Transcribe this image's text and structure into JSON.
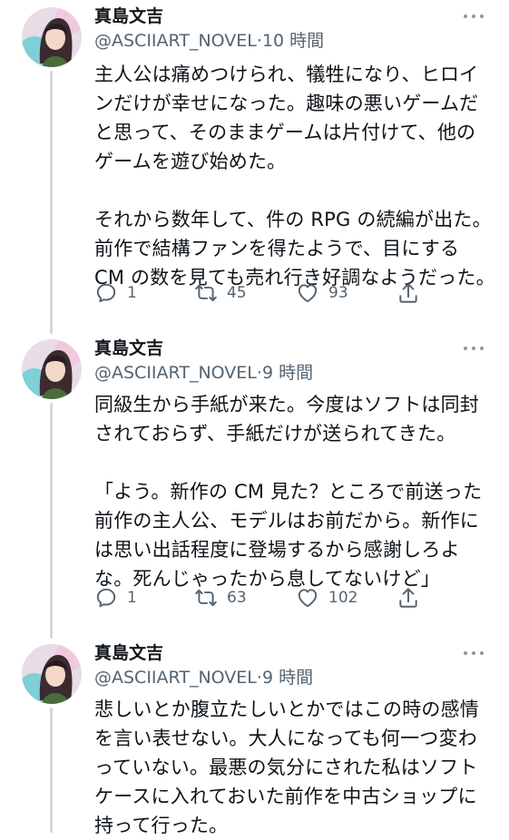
{
  "tweets": [
    {
      "name": "真島文吉",
      "handle": "@ASCIIART_NOVEL",
      "separator": "·",
      "time": "10 時間",
      "lines": [
        "主人公は痛めつけられ、犠牲になり、ヒロイ",
        "ンだけが幸せになった。趣味の悪いゲームだ",
        "と思って、そのままゲームは片付けて、他の",
        "ゲームを遊び始めた。",
        "",
        "それから数年して、件の RPG の続編が出た。",
        "前作で結構ファンを得たようで、目にする",
        "CM の数を見ても売れ行き好調なようだった。"
      ],
      "replies": "1",
      "retweets": "45",
      "likes": "93"
    },
    {
      "name": "真島文吉",
      "handle": "@ASCIIART_NOVEL",
      "separator": "·",
      "time": "9 時間",
      "lines": [
        "同級生から手紙が来た。今度はソフトは同封",
        "されておらず、手紙だけが送られてきた。",
        "",
        "「よう。新作の CM 見た？ところで前送った",
        "前作の主人公、モデルはお前だから。新作に",
        "は思い出話程度に登場するから感謝しろよ",
        "な。死んじゃったから息してないけど」"
      ],
      "replies": "1",
      "retweets": "63",
      "likes": "102"
    },
    {
      "name": "真島文吉",
      "handle": "@ASCIIART_NOVEL",
      "separator": "·",
      "time": "9 時間",
      "lines": [
        "悲しいとか腹立たしいとかではこの時の感情",
        "を言い表せない。大人になっても何一つ変わ",
        "っていない。最悪の気分にされた私はソフト",
        "ケースに入れておいた前作を中古ショップに",
        "持って行った。"
      ]
    }
  ],
  "icons": {
    "reply": "reply-icon",
    "retweet": "retweet-icon",
    "like": "heart-icon",
    "share": "share-icon",
    "more": "more-icon"
  },
  "colors": {
    "text": "#0f1419",
    "secondary": "#536471",
    "thread_line": "#cfd9de"
  }
}
